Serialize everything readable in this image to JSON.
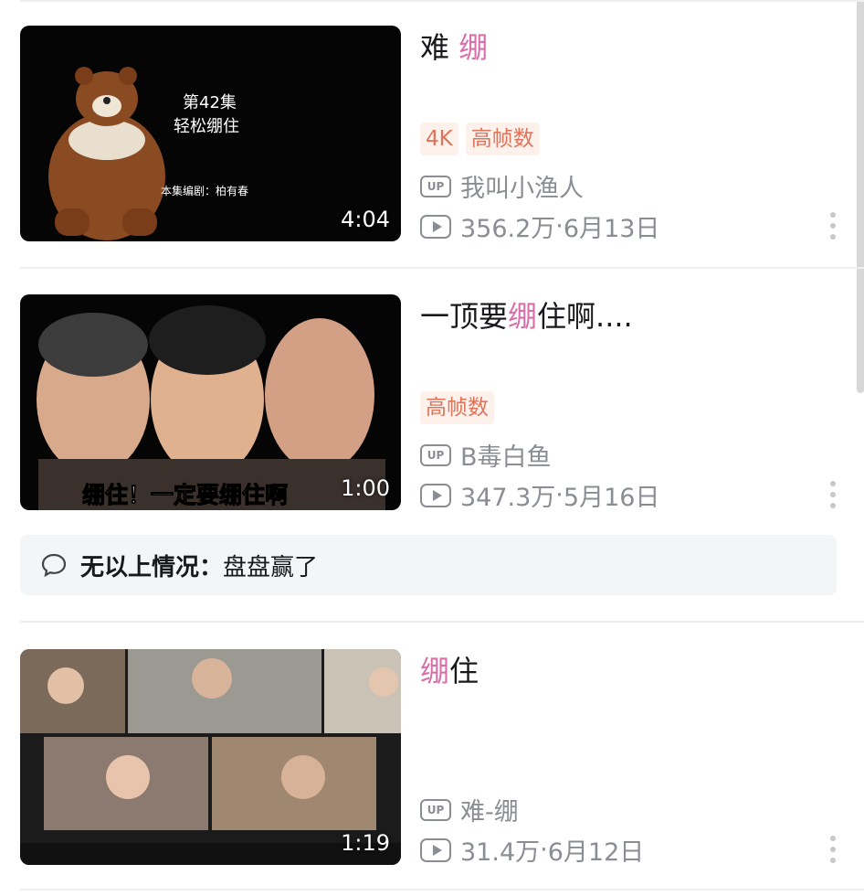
{
  "videos": [
    {
      "title_parts": [
        "难 ",
        "绷",
        ""
      ],
      "tags": [
        "4K",
        "高帧数"
      ],
      "uploader": "我叫小渔人",
      "views": "356.2万",
      "date": "6月13日",
      "duration": "4:04",
      "thumb_text": {
        "episode": "第42集",
        "subtitle": "轻松绷住",
        "credit": "本集编剧：柏有春"
      }
    },
    {
      "title_parts": [
        "一顶要",
        "绷",
        "住啊...."
      ],
      "tags": [
        "高帧数"
      ],
      "uploader": "B毒白鱼",
      "views": "347.3万",
      "date": "5月16日",
      "duration": "1:00",
      "thumb_text": {
        "caption": "绷住！一定要绷住啊"
      }
    },
    {
      "title_parts": [
        "",
        "绷",
        "住"
      ],
      "tags": [],
      "uploader": "难-绷",
      "views": "31.4万",
      "date": "6月12日",
      "duration": "1:19"
    }
  ],
  "comment": {
    "label": "无以上情况：",
    "text": "盘盘赢了"
  },
  "icons": {
    "up": "UP",
    "views": "play-icon",
    "more": "more-icon",
    "comment": "comment-bubble-icon"
  },
  "colors": {
    "highlight": "#d96fa8",
    "tag_text": "#e0735a",
    "tag_bg": "#fdf1ec",
    "meta": "#8a8d93"
  },
  "separator": " · "
}
